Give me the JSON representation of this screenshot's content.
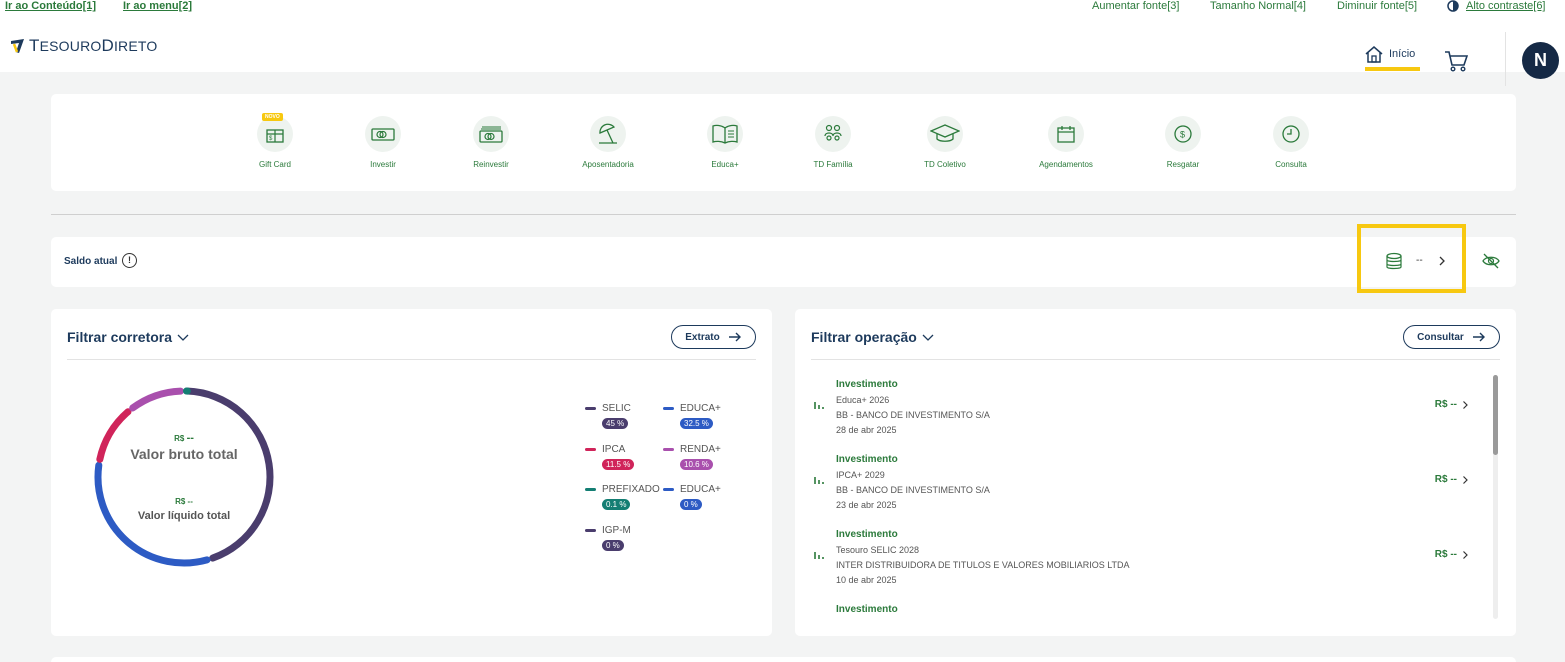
{
  "accessibility": {
    "skip_content": "Ir ao Conteúdo[1]",
    "skip_menu": "Ir ao menu[2]",
    "increase_font": "Aumentar fonte[3]",
    "normal_size": "Tamanho Normal[4]",
    "decrease_font": "Diminuir fonte[5]",
    "high_contrast": "Alto contraste[6]"
  },
  "header": {
    "logo_t": "T",
    "logo_rest1": "ESOURO",
    "logo_d": "D",
    "logo_rest2": "IRETO",
    "nav_home": "Início",
    "avatar_initial": "N"
  },
  "shortcuts": [
    {
      "label": "Gift Card",
      "icon": "gift-card-icon",
      "badge": "NOVO"
    },
    {
      "label": "Investir",
      "icon": "money-icon"
    },
    {
      "label": "Reinvestir",
      "icon": "money-stack-icon"
    },
    {
      "label": "Aposentadoria",
      "icon": "beach-umbrella-icon"
    },
    {
      "label": "Educa+",
      "icon": "book-icon"
    },
    {
      "label": "TD Família",
      "icon": "family-icon"
    },
    {
      "label": "TD Coletivo",
      "icon": "graduation-cap-icon"
    },
    {
      "label": "Agendamentos",
      "icon": "calendar-icon"
    },
    {
      "label": "Resgatar",
      "icon": "dollar-coin-icon"
    },
    {
      "label": "Consulta",
      "icon": "clock-icon"
    }
  ],
  "saldo": {
    "label": "Saldo atual",
    "info": "!",
    "value": "--"
  },
  "broker_panel": {
    "title": "Filtrar corretora",
    "button": "Extrato",
    "gross_prefix": "R$",
    "gross_value": "--",
    "gross_label": "Valor bruto total",
    "net_value": "R$ --",
    "net_label": "Valor líquido total"
  },
  "chart_data": {
    "type": "pie",
    "donut": true,
    "title": "",
    "series": [
      {
        "name": "SELIC",
        "value": 45,
        "label": "45 %",
        "color": "#4a3d6d"
      },
      {
        "name": "EDUCA+",
        "value": 32.5,
        "label": "32.5 %",
        "color": "#2d5bc4"
      },
      {
        "name": "IPCA",
        "value": 11.5,
        "label": "11.5 %",
        "color": "#d0245a"
      },
      {
        "name": "RENDA+",
        "value": 10.6,
        "label": "10.6 %",
        "color": "#a950ad"
      },
      {
        "name": "PREFIXADO",
        "value": 0.1,
        "label": "0.1 %",
        "color": "#147e73"
      },
      {
        "name": "EDUCA+",
        "value": 0,
        "label": "0 %",
        "color": "#2d5bc4"
      },
      {
        "name": "IGP-M",
        "value": 0,
        "label": "0 %",
        "color": "#4a3d6d"
      }
    ]
  },
  "operations_panel": {
    "title": "Filtrar operação",
    "button": "Consultar",
    "items": [
      {
        "kind": "Investimento",
        "title": "Educa+ 2026",
        "broker": "BB - BANCO DE INVESTIMENTO S/A",
        "date": "28 de abr 2025",
        "value": "R$ --"
      },
      {
        "kind": "Investimento",
        "title": "IPCA+ 2029",
        "broker": "BB - BANCO DE INVESTIMENTO S/A",
        "date": "23 de abr 2025",
        "value": "R$ --"
      },
      {
        "kind": "Investimento",
        "title": "Tesouro SELIC 2028",
        "broker": "INTER DISTRIBUIDORA DE TITULOS E VALORES MOBILIARIOS LTDA",
        "date": "10 de abr 2025",
        "value": "R$ --"
      },
      {
        "kind": "Investimento"
      }
    ]
  },
  "colors": {
    "brand_green": "#2b7a3b",
    "navy": "#1d3a5c",
    "highlight": "#f7c810"
  }
}
